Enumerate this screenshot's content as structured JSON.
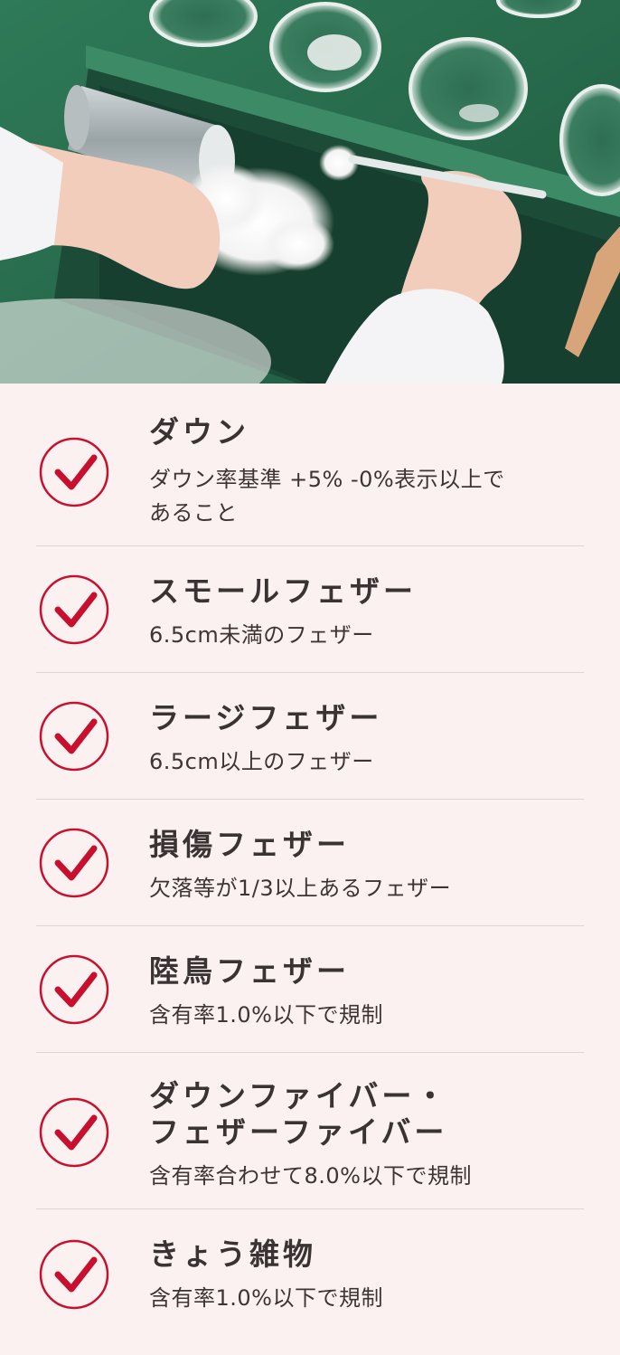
{
  "hero": {
    "image_alt": "down inspection photo"
  },
  "colors": {
    "background": "#fcf1f1",
    "check_red": "#c8102e",
    "divider": "#e3d3d3",
    "text": "#3a3333"
  },
  "items": [
    {
      "title_lines": [
        "ダウン"
      ],
      "desc_lines": [
        "ダウン率基準 +5% -0%表示以上で",
        "あること"
      ]
    },
    {
      "title_lines": [
        "スモールフェザー"
      ],
      "desc_lines": [
        "6.5cm未満のフェザー"
      ]
    },
    {
      "title_lines": [
        "ラージフェザー"
      ],
      "desc_lines": [
        "6.5cm以上のフェザー"
      ]
    },
    {
      "title_lines": [
        "損傷フェザー"
      ],
      "desc_lines": [
        "欠落等が1/3以上あるフェザー"
      ]
    },
    {
      "title_lines": [
        "陸鳥フェザー"
      ],
      "desc_lines": [
        "含有率1.0%以下で規制"
      ]
    },
    {
      "title_lines": [
        "ダウンファイバー・",
        "フェザーファイバー"
      ],
      "desc_lines": [
        "含有率合わせて8.0%以下で規制"
      ]
    },
    {
      "title_lines": [
        "きょう雑物"
      ],
      "desc_lines": [
        "含有率1.0%以下で規制"
      ]
    }
  ]
}
